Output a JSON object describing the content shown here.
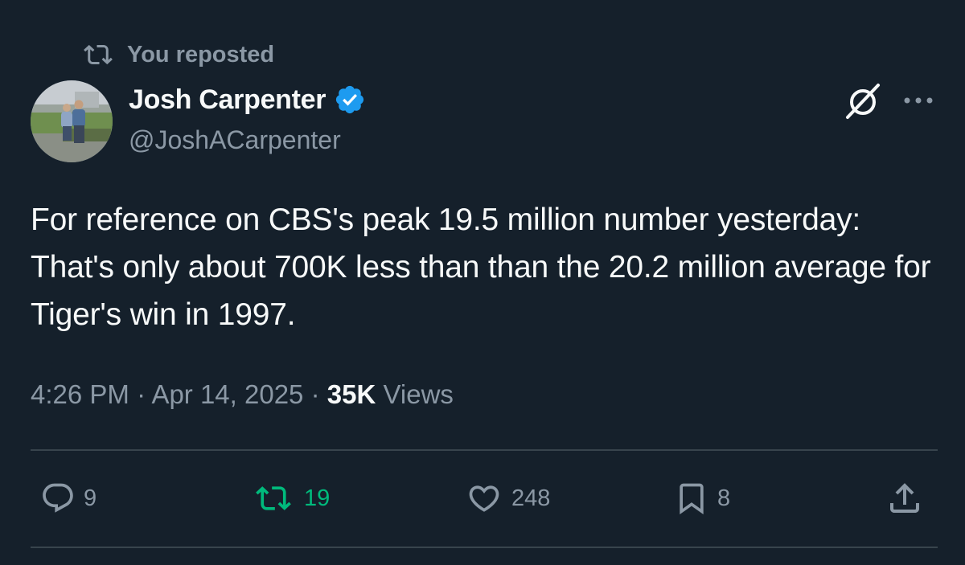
{
  "repost_context": {
    "label": "You reposted",
    "icon": "repost-icon"
  },
  "author": {
    "name": "Josh Carpenter",
    "handle": "@JoshACarpenter",
    "verified": true,
    "verified_color": "#1d9bf0"
  },
  "tweet": {
    "text": "For reference on CBS's peak 19.5 million number yesterday: That's only about 700K less than than the 20.2 million average for Tiger's win in 1997.",
    "time": "4:26 PM",
    "date": "Apr 14, 2025",
    "views_count": "35K",
    "views_label": "Views",
    "separator": "·"
  },
  "actions": {
    "reply": {
      "count": "9",
      "icon": "reply-icon"
    },
    "repost": {
      "count": "19",
      "icon": "repost-icon",
      "active": true,
      "color": "#00ba7c"
    },
    "like": {
      "count": "248",
      "icon": "heart-icon"
    },
    "bookmark": {
      "count": "8",
      "icon": "bookmark-icon"
    },
    "share": {
      "icon": "share-icon"
    }
  },
  "colors": {
    "background": "#15202b",
    "primary_text": "#f7f9f9",
    "secondary_text": "#8b98a5",
    "divider": "#38444d"
  }
}
